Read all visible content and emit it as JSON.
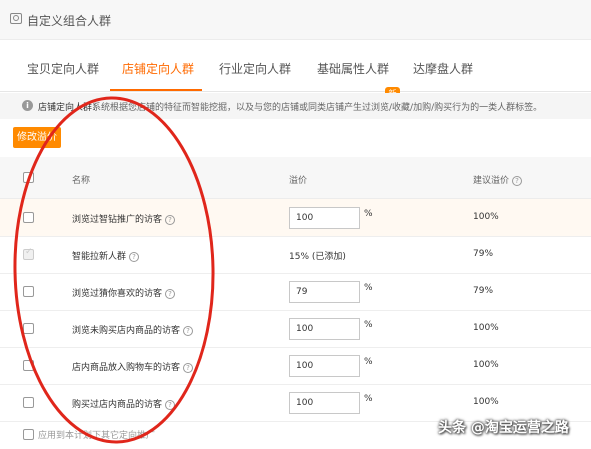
{
  "header": {
    "title": "自定义组合人群"
  },
  "tabs": [
    {
      "label": "宝贝定向人群",
      "active": false
    },
    {
      "label": "店铺定向人群",
      "active": true
    },
    {
      "label": "行业定向人群",
      "active": false
    },
    {
      "label": "基础属性人群",
      "active": false,
      "badge": "新"
    },
    {
      "label": "达摩盘人群",
      "active": false
    }
  ],
  "info": {
    "label": "店铺定向人群：",
    "description": "系统根据您店铺的特征而智能挖掘，以及与您的店铺或同类店铺产生过浏览/收藏/加购/购买行为的一类人群标签。"
  },
  "actions": {
    "edit_price": "修改溢价"
  },
  "table": {
    "columns": {
      "name": "名称",
      "premium": "溢价",
      "suggest": "建议溢价"
    },
    "rows": [
      {
        "name": "浏览过智钻推广的访客",
        "premium": "100",
        "unit": "%",
        "suggest": "100%",
        "checked": false,
        "disabled": false,
        "editable": true
      },
      {
        "name": "智能拉新人群",
        "premium_text": "15% (已添加)",
        "suggest": "79%",
        "checked": true,
        "disabled": true,
        "editable": false
      },
      {
        "name": "浏览过猜你喜欢的访客",
        "premium": "79",
        "unit": "%",
        "suggest": "79%",
        "checked": false,
        "disabled": false,
        "editable": true
      },
      {
        "name": "浏览未购买店内商品的访客",
        "premium": "100",
        "unit": "%",
        "suggest": "100%",
        "checked": false,
        "disabled": false,
        "editable": true
      },
      {
        "name": "店内商品放入购物车的访客",
        "premium": "100",
        "unit": "%",
        "suggest": "100%",
        "checked": false,
        "disabled": false,
        "editable": true
      },
      {
        "name": "购买过店内商品的访客",
        "premium": "100",
        "unit": "%",
        "suggest": "100%",
        "checked": false,
        "disabled": false,
        "editable": true
      }
    ]
  },
  "footer": {
    "apply_text": "应用到本计划下其它定向推广"
  },
  "watermark": "头条 @淘宝运营之路",
  "colors": {
    "accent": "#ff6a00",
    "button": "#ff8a00",
    "annotation": "#e0261b"
  }
}
